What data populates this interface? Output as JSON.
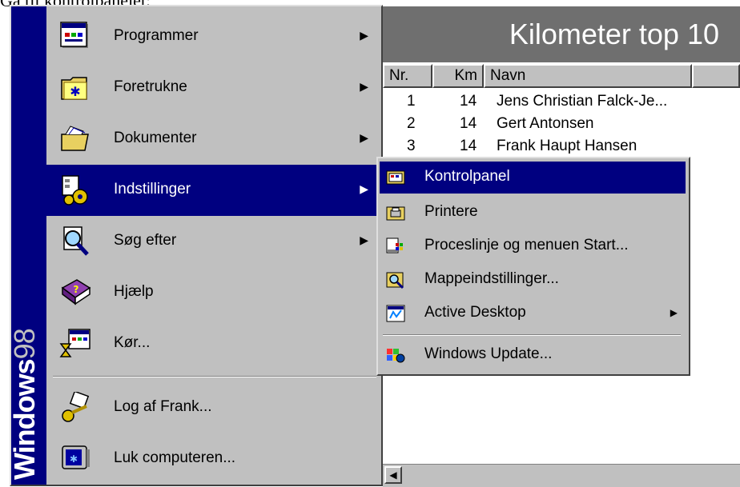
{
  "caption": "Gå til kontrolpanelet:",
  "app": {
    "title": "Kilometer top 10",
    "columns": [
      "Nr.",
      "Km",
      "Navn"
    ],
    "rows": [
      {
        "nr": "1",
        "km": "14",
        "name": "Jens Christian Falck-Je..."
      },
      {
        "nr": "2",
        "km": "14",
        "name": "Gert Antonsen"
      },
      {
        "nr": "3",
        "km": "14",
        "name": "Frank Haupt Hansen"
      }
    ]
  },
  "start_menu": {
    "banner_bold": "Windows",
    "banner_light": "98",
    "items": [
      {
        "label": "Programmer",
        "icon": "programs-icon",
        "submenu": true
      },
      {
        "label": "Foretrukne",
        "icon": "favorites-folder-icon",
        "submenu": true
      },
      {
        "label": "Dokumenter",
        "icon": "documents-folder-icon",
        "submenu": true
      },
      {
        "label": "Indstillinger",
        "icon": "settings-icon",
        "submenu": true,
        "selected": true
      },
      {
        "label": "Søg efter",
        "icon": "search-icon",
        "submenu": true
      },
      {
        "label": "Hjælp",
        "icon": "help-book-icon",
        "submenu": false
      },
      {
        "label": "Kør...",
        "icon": "run-icon",
        "submenu": false
      },
      {
        "label": "Log af Frank...",
        "icon": "logoff-key-icon",
        "submenu": false
      },
      {
        "label": "Luk computeren...",
        "icon": "shutdown-monitor-icon",
        "submenu": false
      }
    ]
  },
  "settings_submenu": {
    "items": [
      {
        "label": "Kontrolpanel",
        "icon": "control-panel-icon",
        "selected": true
      },
      {
        "label": "Printere",
        "icon": "printers-icon"
      },
      {
        "label": "Proceslinje og menuen Start...",
        "icon": "taskbar-icon"
      },
      {
        "label": "Mappeindstillinger...",
        "icon": "folder-options-icon"
      },
      {
        "label": "Active Desktop",
        "icon": "active-desktop-icon",
        "submenu": true
      },
      {
        "label": "Windows Update...",
        "icon": "windows-update-icon"
      }
    ]
  },
  "colors": {
    "menu_bg": "#c0c0c0",
    "highlight": "#000080",
    "banner": "#000080",
    "header_bg": "#6f6f6f"
  }
}
